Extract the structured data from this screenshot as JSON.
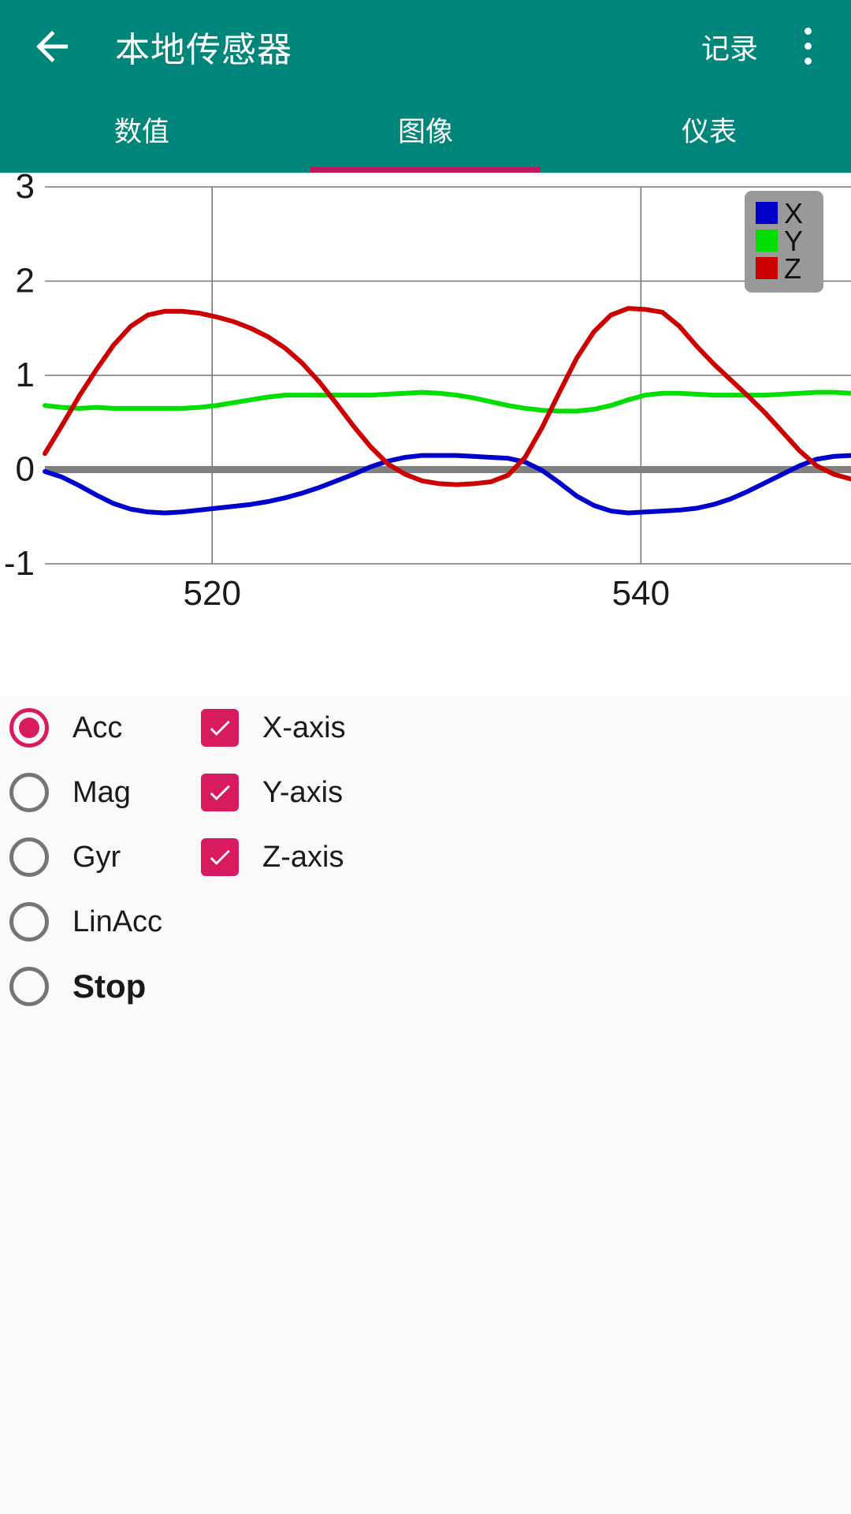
{
  "appbar": {
    "back_icon": "arrow-left-icon",
    "title": "本地传感器",
    "record_label": "记录",
    "overflow_icon": "more-vertical-icon"
  },
  "tabs": [
    {
      "label": "数值",
      "active": false
    },
    {
      "label": "图像",
      "active": true
    },
    {
      "label": "仪表",
      "active": false
    }
  ],
  "colors": {
    "primary": "#00857B",
    "accent": "#D81B60",
    "indicator": "#C2185B",
    "series_x": "#0000CC",
    "series_y": "#00DD00",
    "series_z": "#CC0000",
    "legend_bg": "#999999",
    "zero_line": "#808080"
  },
  "sensor_options": [
    {
      "label": "Acc",
      "selected": true,
      "bold": false
    },
    {
      "label": "Mag",
      "selected": false,
      "bold": false
    },
    {
      "label": "Gyr",
      "selected": false,
      "bold": false
    },
    {
      "label": "LinAcc",
      "selected": false,
      "bold": false
    },
    {
      "label": "Stop",
      "selected": false,
      "bold": true
    }
  ],
  "axis_options": [
    {
      "label": "X-axis",
      "checked": true
    },
    {
      "label": "Y-axis",
      "checked": true
    },
    {
      "label": "Z-axis",
      "checked": true
    }
  ],
  "chart_data": {
    "type": "line",
    "title": "",
    "xlabel": "",
    "ylabel": "",
    "xlim": [
      512.2,
      549.8
    ],
    "ylim": [
      -1,
      3
    ],
    "xticks": [
      520,
      540
    ],
    "xtick_labels": [
      "520",
      "540"
    ],
    "yticks": [
      -1,
      0,
      1,
      2,
      3
    ],
    "ytick_labels": [
      "-1",
      "0",
      "1",
      "2",
      "3"
    ],
    "grid": true,
    "zero_line": 0,
    "legend": {
      "position": "top-right",
      "entries": [
        {
          "name": "X",
          "color": "#0000CC"
        },
        {
          "name": "Y",
          "color": "#00DD00"
        },
        {
          "name": "Z",
          "color": "#CC0000"
        }
      ]
    },
    "x": [
      512.2,
      513.0,
      513.8,
      514.6,
      515.4,
      516.2,
      517.0,
      517.8,
      518.6,
      519.4,
      520.2,
      521.0,
      521.8,
      522.6,
      523.4,
      524.2,
      525.0,
      525.8,
      526.6,
      527.4,
      528.2,
      529.0,
      529.8,
      530.6,
      531.4,
      532.2,
      533.0,
      533.8,
      534.6,
      535.4,
      536.2,
      537.0,
      537.8,
      538.6,
      539.4,
      540.2,
      541.0,
      541.8,
      542.6,
      543.4,
      544.2,
      545.0,
      545.8,
      546.6,
      547.4,
      548.2,
      549.0,
      549.8
    ],
    "series": [
      {
        "name": "X",
        "color": "#0000CC",
        "values": [
          -0.02,
          -0.08,
          -0.17,
          -0.27,
          -0.36,
          -0.42,
          -0.45,
          -0.46,
          -0.45,
          -0.43,
          -0.41,
          -0.39,
          -0.37,
          -0.34,
          -0.3,
          -0.25,
          -0.19,
          -0.12,
          -0.05,
          0.03,
          0.09,
          0.13,
          0.15,
          0.15,
          0.15,
          0.14,
          0.13,
          0.12,
          0.08,
          -0.01,
          -0.14,
          -0.28,
          -0.38,
          -0.44,
          -0.46,
          -0.45,
          -0.44,
          -0.43,
          -0.41,
          -0.37,
          -0.31,
          -0.23,
          -0.14,
          -0.05,
          0.04,
          0.11,
          0.14,
          0.15
        ]
      },
      {
        "name": "Y",
        "color": "#00DD00",
        "values": [
          0.68,
          0.66,
          0.65,
          0.66,
          0.65,
          0.65,
          0.65,
          0.65,
          0.65,
          0.66,
          0.68,
          0.71,
          0.74,
          0.77,
          0.79,
          0.79,
          0.79,
          0.79,
          0.79,
          0.79,
          0.8,
          0.81,
          0.82,
          0.81,
          0.79,
          0.76,
          0.72,
          0.68,
          0.65,
          0.63,
          0.62,
          0.62,
          0.64,
          0.68,
          0.74,
          0.79,
          0.81,
          0.81,
          0.8,
          0.79,
          0.79,
          0.79,
          0.79,
          0.8,
          0.81,
          0.82,
          0.82,
          0.81
        ]
      },
      {
        "name": "Z",
        "color": "#CC0000",
        "values": [
          0.17,
          0.47,
          0.78,
          1.06,
          1.32,
          1.52,
          1.64,
          1.68,
          1.68,
          1.66,
          1.62,
          1.57,
          1.5,
          1.41,
          1.29,
          1.13,
          0.93,
          0.7,
          0.46,
          0.24,
          0.06,
          -0.05,
          -0.12,
          -0.15,
          -0.16,
          -0.15,
          -0.13,
          -0.06,
          0.13,
          0.45,
          0.82,
          1.18,
          1.46,
          1.64,
          1.71,
          1.7,
          1.67,
          1.52,
          1.31,
          1.12,
          0.95,
          0.78,
          0.6,
          0.4,
          0.2,
          0.04,
          -0.05,
          -0.1
        ]
      }
    ]
  }
}
